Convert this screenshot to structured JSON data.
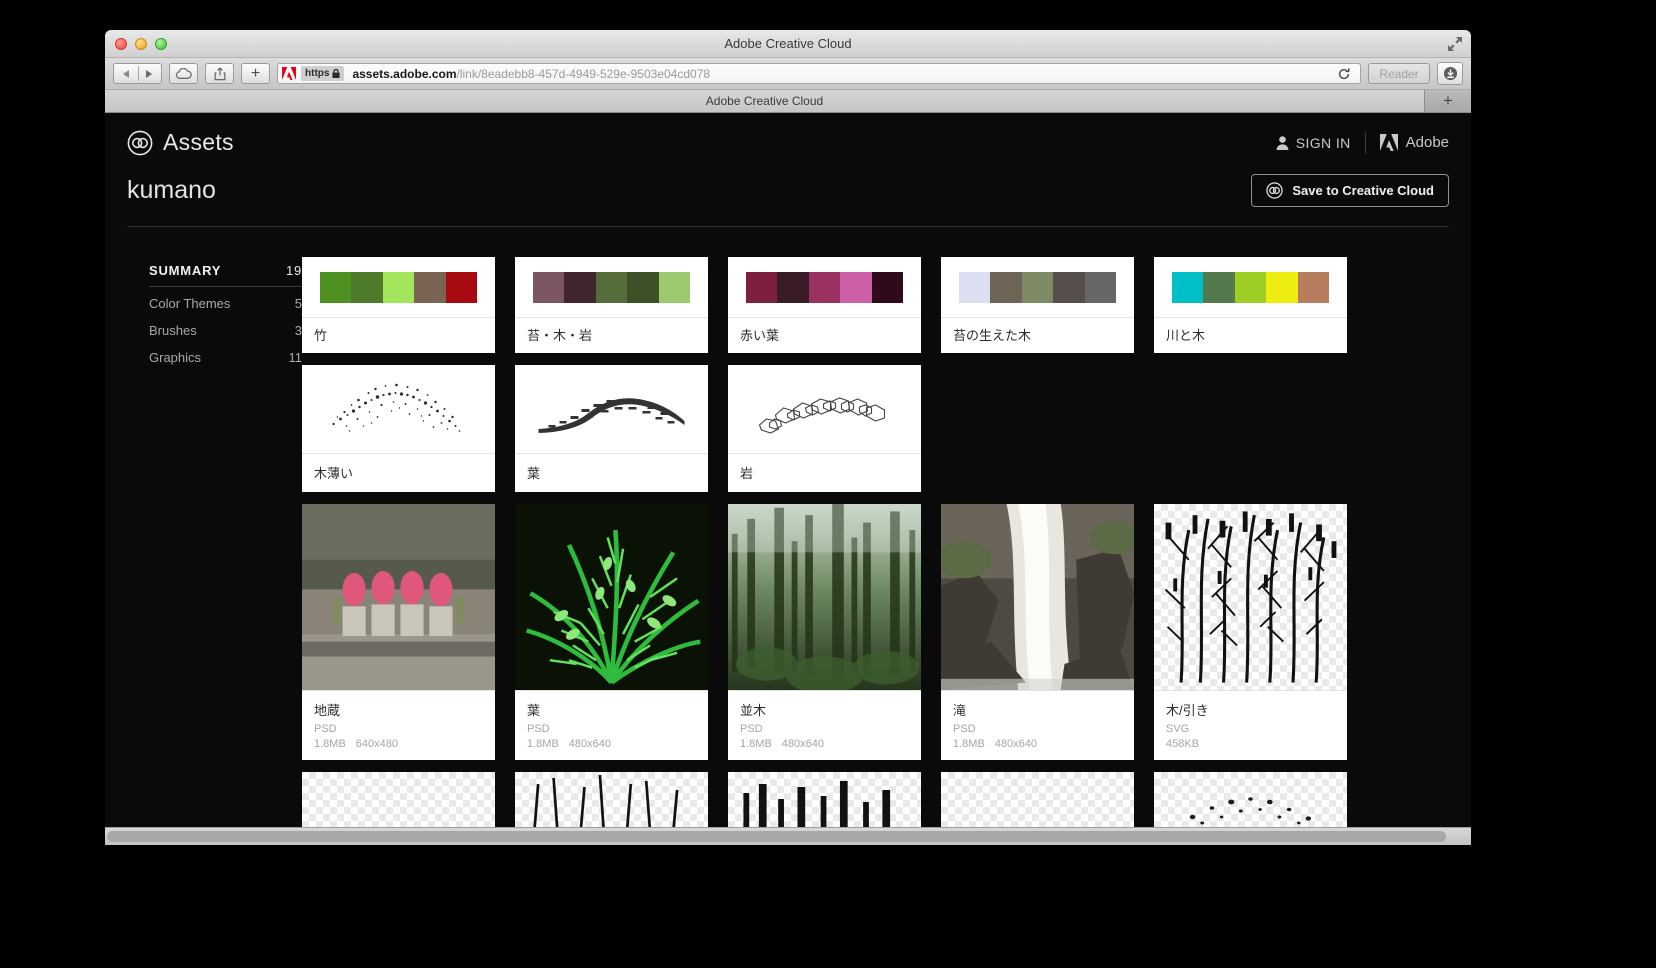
{
  "browser": {
    "window_title": "Adobe Creative Cloud",
    "tab_title": "Adobe Creative Cloud",
    "https_label": "https",
    "url_domain": "assets.adobe.com",
    "url_path": "/link/8eadebb8-457d-4949-529e-9503e04cd078",
    "reader_label": "Reader",
    "new_tab_label": "+",
    "add_bookmark_label": "+"
  },
  "header": {
    "app_name": "Assets",
    "sign_in_label": "SIGN IN",
    "brand_label": "Adobe"
  },
  "subheader": {
    "collection_title": "kumano",
    "save_button_label": "Save to Creative Cloud"
  },
  "sidebar": {
    "summary_label": "SUMMARY",
    "summary_count": "19",
    "items": [
      {
        "label": "Color Themes",
        "count": "5"
      },
      {
        "label": "Brushes",
        "count": "3"
      },
      {
        "label": "Graphics",
        "count": "11"
      }
    ]
  },
  "assets": {
    "color_themes": [
      {
        "name": "竹",
        "colors": [
          "#4d9121",
          "#4e7a2c",
          "#a3e65b",
          "#7a6552",
          "#a60b12"
        ]
      },
      {
        "name": "苔・木・岩",
        "colors": [
          "#7c5660",
          "#412630",
          "#556d3b",
          "#3d5128",
          "#9ac96e"
        ]
      },
      {
        "name": "赤い葉",
        "colors": [
          "#7d1f3d",
          "#3a1c26",
          "#993260",
          "#cc5fa5",
          "#2e0a1c"
        ]
      },
      {
        "name": "苔の生えた木",
        "colors": [
          "#dcdef2",
          "#6f6557",
          "#7d8a63",
          "#564e4a",
          "#666666"
        ]
      },
      {
        "name": "川と木",
        "colors": [
          "#00bfc6",
          "#537a4c",
          "#9ecd25",
          "#eded11",
          "#b57d5b"
        ]
      }
    ],
    "brushes": [
      {
        "name": "木薄い",
        "style": "speckle"
      },
      {
        "name": "葉",
        "style": "leaf-stroke"
      },
      {
        "name": "岩",
        "style": "rock-chain"
      }
    ],
    "graphics": [
      {
        "name": "地蔵",
        "format": "PSD",
        "size": "1.8MB",
        "dimensions": "640x480",
        "thumb": "jizo"
      },
      {
        "name": "葉",
        "format": "PSD",
        "size": "1.8MB",
        "dimensions": "480x640",
        "thumb": "fern"
      },
      {
        "name": "並木",
        "format": "PSD",
        "size": "1.8MB",
        "dimensions": "480x640",
        "thumb": "forest"
      },
      {
        "name": "滝",
        "format": "PSD",
        "size": "1.8MB",
        "dimensions": "480x640",
        "thumb": "waterfall"
      },
      {
        "name": "木/引き",
        "format": "SVG",
        "size": "458KB",
        "dimensions": "",
        "thumb": "tree-vector"
      }
    ]
  },
  "colors": {
    "page_background": "#0a0a0a",
    "card_background": "#ffffff",
    "accent_text": "#e8e8e8",
    "muted_text": "#a9a9a9"
  }
}
